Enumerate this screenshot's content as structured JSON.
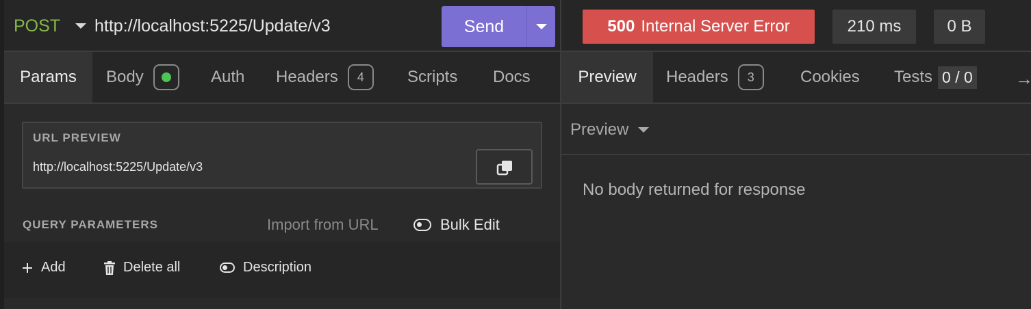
{
  "request": {
    "method": "POST",
    "url": "http://localhost:5225/Update/v3",
    "send_label": "Send",
    "method_color": "#86b84a",
    "send_color": "#7b6fd4"
  },
  "request_tabs": [
    {
      "label": "Params",
      "active": true
    },
    {
      "label": "Body",
      "indicator": "green-dot"
    },
    {
      "label": "Auth"
    },
    {
      "label": "Headers",
      "count": "4"
    },
    {
      "label": "Scripts"
    },
    {
      "label": "Docs"
    }
  ],
  "url_preview": {
    "title": "URL PREVIEW",
    "url": "http://localhost:5225/Update/v3",
    "copy_icon": "copy-icon"
  },
  "query_params": {
    "title": "QUERY PARAMETERS",
    "import_label": "Import from URL",
    "bulk_edit_label": "Bulk Edit",
    "actions": [
      {
        "label": "Add",
        "icon": "plus-icon"
      },
      {
        "label": "Delete all",
        "icon": "trash-icon"
      },
      {
        "label": "Description",
        "icon": "toggle-icon"
      }
    ]
  },
  "response": {
    "status_code": "500",
    "status_text": "Internal Server Error",
    "status_color": "#d6504d",
    "time": "210 ms",
    "size": "0 B",
    "tabs": [
      {
        "label": "Preview",
        "active": true
      },
      {
        "label": "Headers",
        "count": "3"
      },
      {
        "label": "Cookies"
      },
      {
        "label": "Tests",
        "badge": "0 / 0"
      }
    ],
    "more_icon": "→",
    "preview_mode": "Preview",
    "empty_message": "No body returned for response"
  }
}
